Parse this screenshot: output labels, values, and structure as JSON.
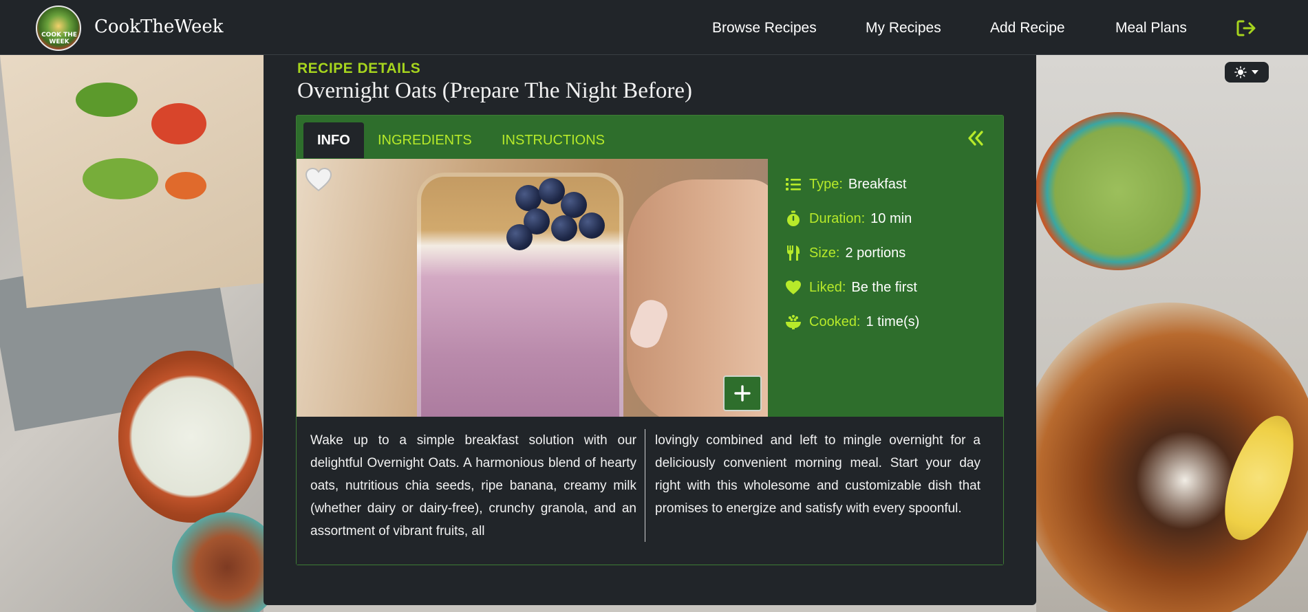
{
  "app": {
    "brand": "CookTheWeek",
    "logo_text": "COOK THE WEEK"
  },
  "nav": {
    "items": [
      {
        "label": "Browse Recipes"
      },
      {
        "label": "My Recipes"
      },
      {
        "label": "Add Recipe"
      },
      {
        "label": "Meal Plans"
      }
    ],
    "logout_icon": "logout-icon"
  },
  "theme_toggle": {
    "icon": "sun-icon",
    "caret": "caret-down-icon"
  },
  "recipe": {
    "eyebrow": "RECIPE DETAILS",
    "title": "Overnight Oats (Prepare The Night Before)",
    "tabs": [
      {
        "label": "INFO",
        "active": true
      },
      {
        "label": "INGREDIENTS",
        "active": false
      },
      {
        "label": "INSTRUCTIONS",
        "active": false
      }
    ],
    "info": [
      {
        "key": "Type:",
        "value": "Breakfast",
        "icon": "list-icon"
      },
      {
        "key": "Duration:",
        "value": "10 min",
        "icon": "stopwatch-icon"
      },
      {
        "key": "Size:",
        "value": "2 portions",
        "icon": "utensils-icon"
      },
      {
        "key": "Liked:",
        "value": "Be the first",
        "icon": "heart-icon"
      },
      {
        "key": "Cooked:",
        "value": "1 time(s)",
        "icon": "bowl-food-icon"
      }
    ],
    "description_left": "Wake up to a simple breakfast solution with our delightful Overnight Oats. A harmonious blend of hearty oats, nutritious chia seeds, ripe banana, creamy milk (whether dairy or dairy-free), crunchy granola, and an assortment of vibrant fruits, all",
    "description_right": "lovingly combined and left to mingle overnight for a deliciously convenient morning meal. Start your day right with this wholesome and customizable dish that promises to energize and satisfy with every spoonful."
  },
  "colors": {
    "accent": "#a6d41e",
    "panel_green": "#2e6e2c",
    "dark": "#212529"
  }
}
